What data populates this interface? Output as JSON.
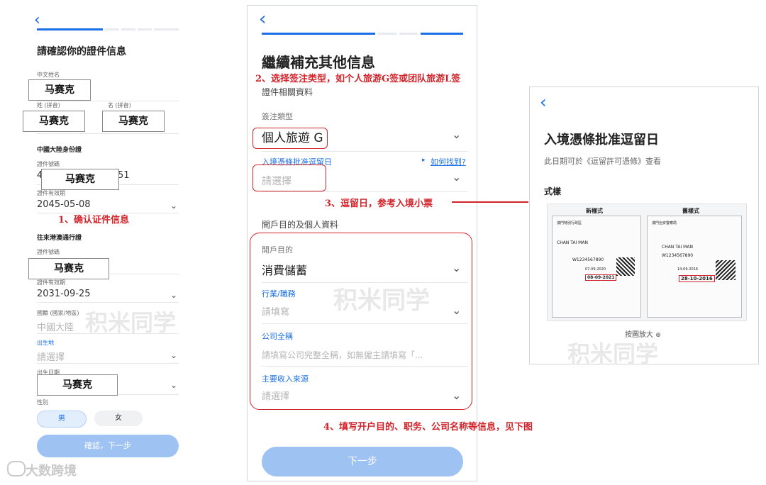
{
  "colors": {
    "accent": "#1a6fe8",
    "annotation_red": "#d2232a",
    "button": "#9ec3f2"
  },
  "panel1": {
    "title": "請確認你的證件信息",
    "chinese_name_label": "中文姓名",
    "surname_label": "姓 (拼音)",
    "given_label": "名 (拼音)",
    "mainland_id_label": "中國大陸身份證",
    "id_no_label": "證件號碼",
    "id_no_partial_left": "4",
    "id_no_partial_right": "51",
    "validity_label": "證件有效期",
    "validity_value": "2045-05-08",
    "hkmo_permit_label": "往來港澳通行證",
    "permit_no_label": "證件號碼",
    "permit_validity_label": "證件有效期",
    "permit_validity_value": "2031-09-25",
    "nationality_label": "國籍 (國家/地區)",
    "nationality_value": "中國大陸",
    "birthplace_label": "出生地",
    "birthplace_placeholder": "請選擇",
    "birthdate_label": "出生日期",
    "gender_label": "性別",
    "male": "男",
    "female": "女",
    "confirm_button": "確認，下一步",
    "name_overlay": "马赛克"
  },
  "panel2": {
    "title": "繼續補充其他信息",
    "section1": "證件相關資料",
    "visa_type_label": "簽注類型",
    "visa_type_value": "個人旅遊 G",
    "stay_label": "入境憑條批准逗留日",
    "how_to_find": "如何找到?",
    "stay_placeholder": "請選擇",
    "section2": "開戶目的及個人資料",
    "purpose_label": "開戶目的",
    "purpose_value": "消費儲蓄",
    "occupation_label": "行業/職務",
    "occupation_placeholder": "請填寫",
    "company_label": "公司全稱",
    "company_placeholder": "請填寫公司完整全稱，如無僱主請填寫「...",
    "income_label": "主要收入來源",
    "income_placeholder": "請選擇",
    "next_button": "下一步"
  },
  "panel3": {
    "title": "入境憑條批准逗留日",
    "subtitle": "此日期可於《逗留許可憑條》查看",
    "sample_label": "式樣",
    "new_style": "新樣式",
    "old_style": "舊樣式",
    "new_slip": {
      "header": "澳門特別行政區",
      "name": "CHAN TAI MAN",
      "doc_no": "W1234567890",
      "date1": "07-09-2020",
      "date2": "08-09-2021"
    },
    "old_slip": {
      "header": "澳門治安警察局",
      "name": "CHAN TAI MAN",
      "doc_no": "W1234567890",
      "date1": "14-09-2016",
      "date2": "28-10-2016"
    },
    "zoom_hint": "按圖放大"
  },
  "annotations": {
    "a1": "1、确认证件信息",
    "a2": "2、选择签注类型，如个人旅游G签或团队旅游L签",
    "a3": "3、逗留日，参考入境小票",
    "a4": "4、填写开户目的、职务、公司名称等信息，见下图"
  },
  "watermark": {
    "text": "积米同学",
    "brand": "大数跨境"
  }
}
